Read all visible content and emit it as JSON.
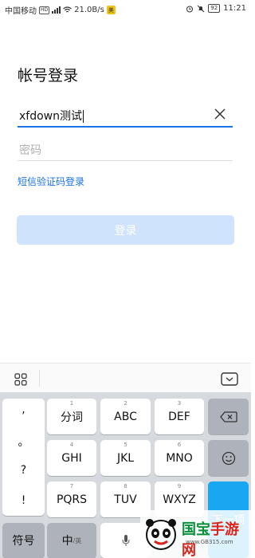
{
  "status_bar": {
    "carrier": "中国移动",
    "net_tag": "HD",
    "net_speed": "21.0B/s",
    "battery": "92",
    "time": "11:21"
  },
  "login": {
    "title": "帐号登录",
    "account_value": "xfdown测试",
    "password_placeholder": "密码",
    "sms_login_link": "短信验证码登录",
    "login_button": "登录"
  },
  "keyboard": {
    "punctuation": [
      ",",
      "。",
      "?",
      "!"
    ],
    "rows": [
      [
        {
          "sub": "1",
          "label": "分词"
        },
        {
          "sub": "2",
          "label": "ABC"
        },
        {
          "sub": "3",
          "label": "DEF"
        }
      ],
      [
        {
          "sub": "4",
          "label": "GHI"
        },
        {
          "sub": "5",
          "label": "JKL"
        },
        {
          "sub": "6",
          "label": "MNO"
        }
      ],
      [
        {
          "sub": "7",
          "label": "PQRS"
        },
        {
          "sub": "8",
          "label": "TUV"
        },
        {
          "sub": "9",
          "label": "WXYZ"
        }
      ]
    ],
    "symbol_key": "符号",
    "lang_key": "中",
    "lang_key_sub": "/英",
    "next_key": "下一项"
  },
  "watermark": {
    "brand_green": "国宝",
    "brand_red": "手游网",
    "url": "www.GB315.com"
  },
  "colors": {
    "accent": "#1a73e8",
    "login_disabled": "#cfe3fd",
    "next_key": "#1aa7f2"
  }
}
